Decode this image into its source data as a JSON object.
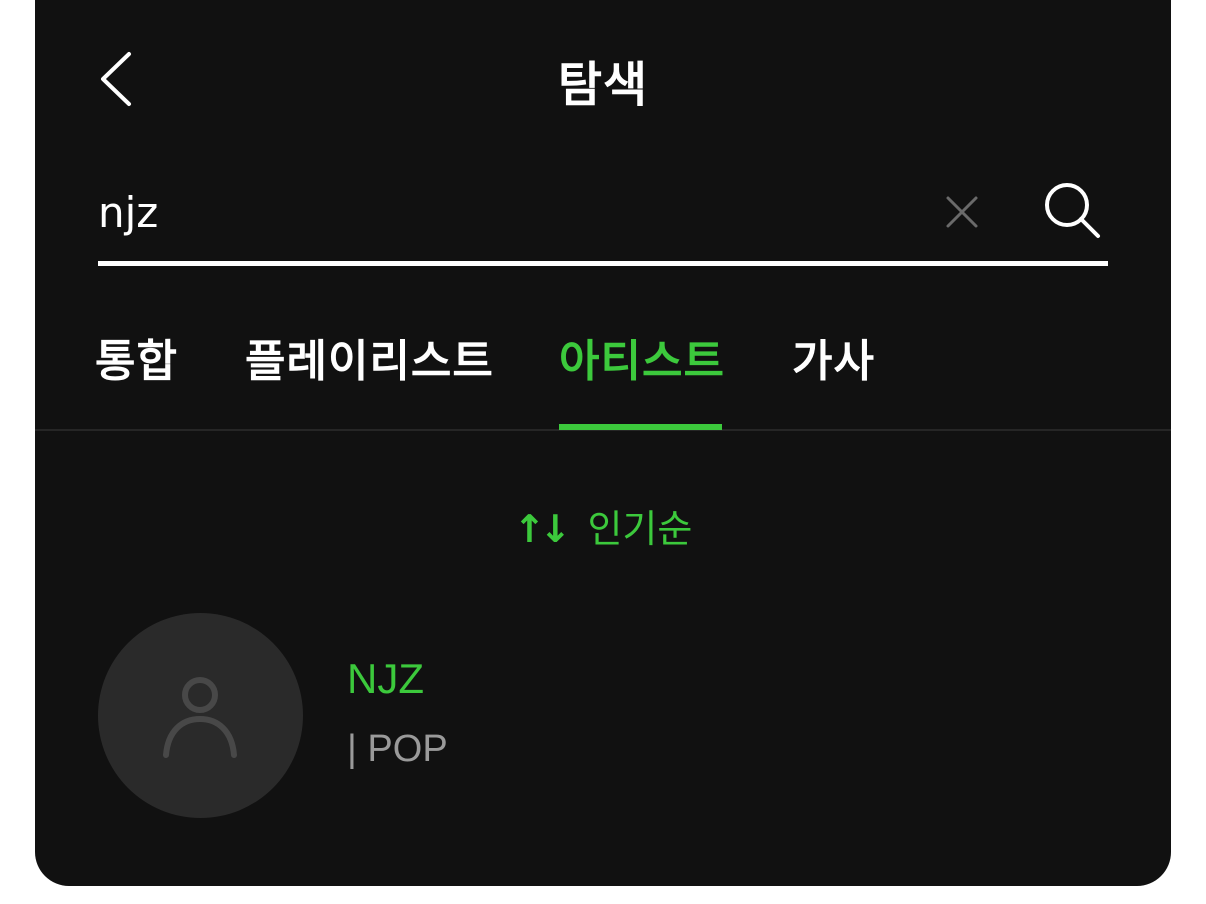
{
  "header": {
    "title": "탐색",
    "back_icon": "chevron-left-icon"
  },
  "search": {
    "value": "njz",
    "clear_icon": "close-icon",
    "submit_icon": "search-icon"
  },
  "tabs": [
    {
      "label": "통합",
      "active": false
    },
    {
      "label": "플레이리스트",
      "active": false
    },
    {
      "label": "아티스트",
      "active": true
    },
    {
      "label": "가사",
      "active": false
    }
  ],
  "sort": {
    "icon": "sort-arrows-icon",
    "arrows": "↑↓",
    "label": "인기순"
  },
  "results": [
    {
      "name": "NJZ",
      "genre": "| POP",
      "avatar_icon": "person-icon"
    }
  ],
  "colors": {
    "accent": "#3cc93c",
    "background": "#111111",
    "text": "#ffffff",
    "muted": "#9a9a9a"
  }
}
